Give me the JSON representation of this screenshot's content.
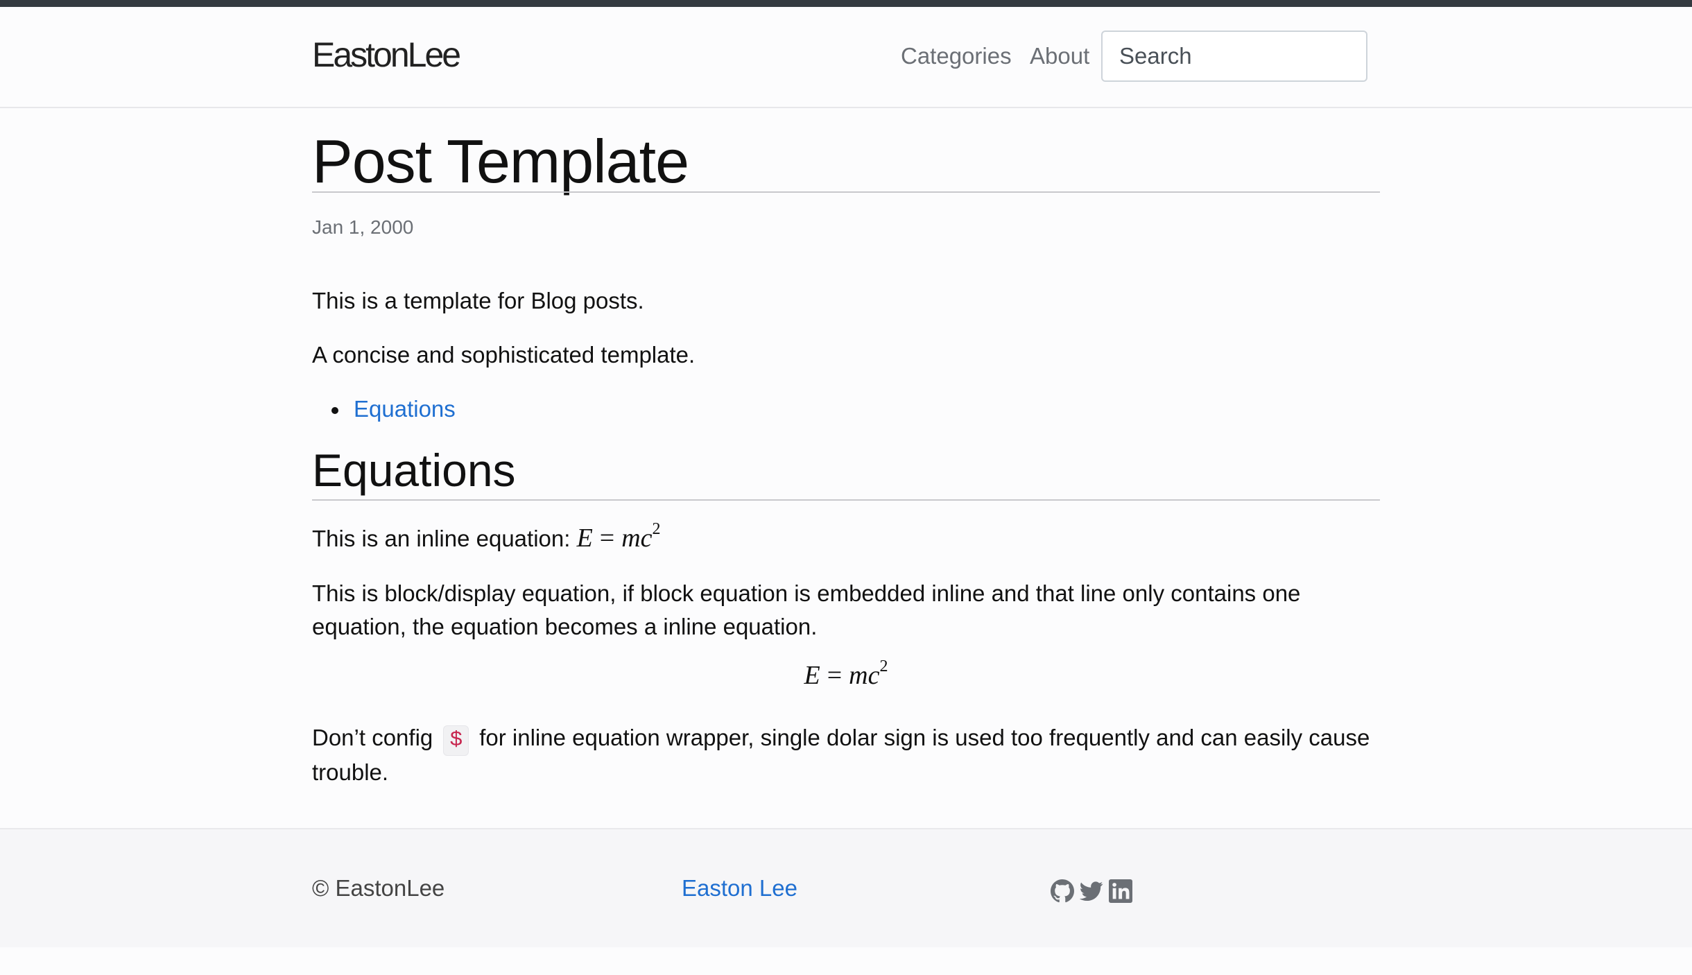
{
  "brand": "EastonLee",
  "nav": {
    "categories": "Categories",
    "about": "About",
    "search_placeholder": "Search"
  },
  "post": {
    "title": "Post Template",
    "date": "Jan 1, 2000",
    "intro": "This is a template for Blog posts.",
    "tagline": "A concise and sophisticated template.",
    "toc": [
      "Equations"
    ],
    "section_heading": "Equations",
    "inline_eq_text": "This is an inline equation: ",
    "eq": {
      "lhs": "E",
      "op": "=",
      "rhs": "mc",
      "exp": "2"
    },
    "block_eq_text": "This is block/display equation, if block equation is embedded inline and that line only contains one equation, the equation becomes a inline equation.",
    "config_pre": "Don’t config ",
    "config_code": "$",
    "config_post": " for inline equation wrapper, single dolar sign is used too frequently and can easily cause trouble."
  },
  "footer": {
    "copyright": "© EastonLee",
    "author_link": "Easton Lee",
    "social_icons": [
      "github-icon",
      "twitter-icon",
      "linkedin-icon"
    ],
    "icon_color": "#6b6f75"
  },
  "colors": {
    "link": "#1f6fd1",
    "topbar": "#343a40",
    "code": "#c7254e"
  }
}
